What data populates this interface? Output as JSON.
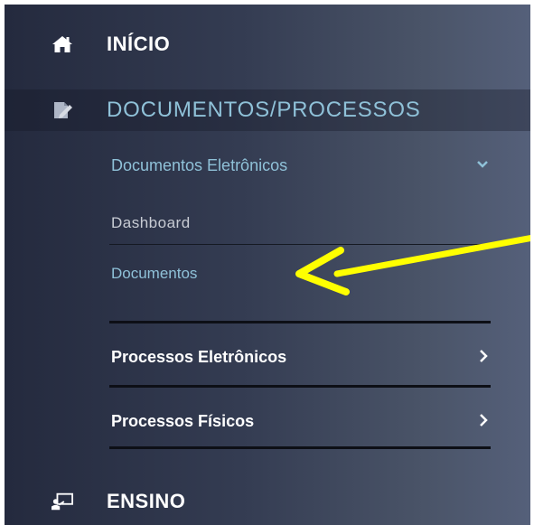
{
  "menu": {
    "inicio": {
      "label": "INÍCIO",
      "icon": "home-icon"
    },
    "documentos_processos": {
      "label": "DOCUMENTOS/PROCESSOS",
      "icon": "document-edit-icon"
    },
    "ensino": {
      "label": "ENSINO",
      "icon": "classroom-icon"
    }
  },
  "submenu": {
    "documentos_eletronicos": {
      "label": "Documentos Eletrônicos",
      "icon": "chevron-down-icon",
      "items": [
        {
          "label": "Dashboard"
        },
        {
          "label": "Documentos"
        }
      ]
    },
    "processos_eletronicos": {
      "label": "Processos Eletrônicos",
      "icon": "chevron-right-icon"
    },
    "processos_fisicos": {
      "label": "Processos Físicos",
      "icon": "chevron-right-icon"
    }
  },
  "colors": {
    "sidebar_dark": "#242a3e",
    "sidebar_light": "#55607a",
    "accent_text": "#8fc1d8",
    "annotation_arrow": "#ffff00"
  }
}
